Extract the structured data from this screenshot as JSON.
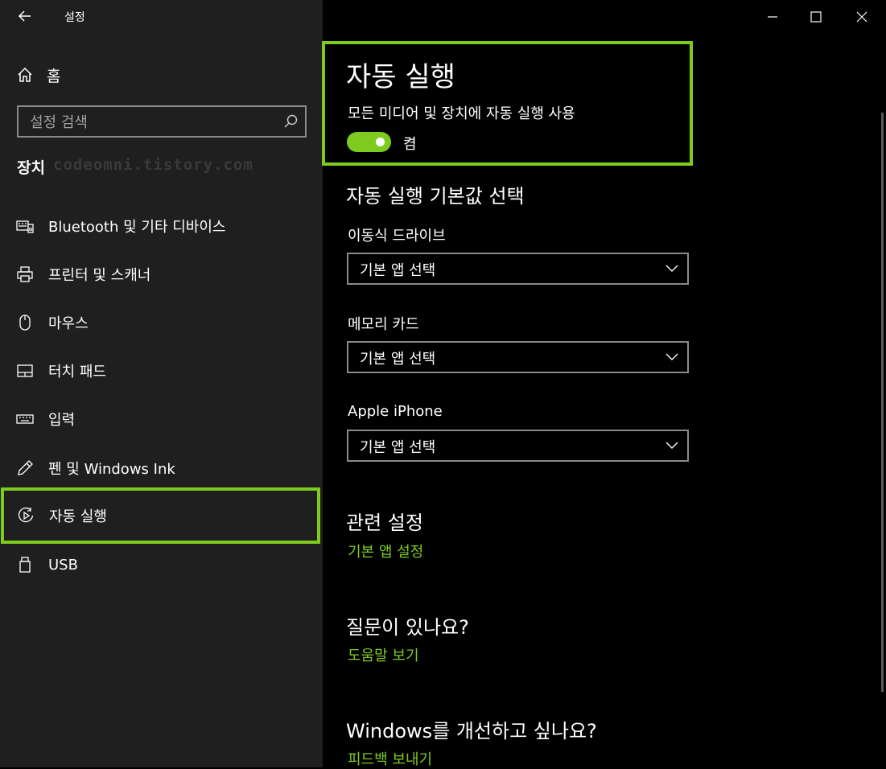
{
  "window": {
    "title": "설정"
  },
  "sidebar": {
    "home_label": "홈",
    "search_placeholder": "설정 검색",
    "section_heading": "장치",
    "watermark": "codeomni.tistory.com",
    "items": [
      {
        "label": "Bluetooth 및 기타 디바이스",
        "icon": "bluetooth-devices-icon"
      },
      {
        "label": "프린터 및 스캐너",
        "icon": "printer-icon"
      },
      {
        "label": "마우스",
        "icon": "mouse-icon"
      },
      {
        "label": "터치 패드",
        "icon": "touchpad-icon"
      },
      {
        "label": "입력",
        "icon": "keyboard-icon"
      },
      {
        "label": "펜 및 Windows Ink",
        "icon": "pen-icon"
      },
      {
        "label": "자동 실행",
        "icon": "autoplay-icon",
        "active": true
      },
      {
        "label": "USB",
        "icon": "usb-icon"
      }
    ]
  },
  "main": {
    "title": "자동 실행",
    "toggle_description": "모든 미디어 및 장치에 자동 실행 사용",
    "toggle_state": "켬",
    "toggle_on": true,
    "defaults_title": "자동 실행 기본값 선택",
    "fields": [
      {
        "label": "이동식 드라이브",
        "value": "기본 앱 선택"
      },
      {
        "label": "메모리 카드",
        "value": "기본 앱 선택"
      },
      {
        "label": "Apple iPhone",
        "value": "기본 앱 선택"
      }
    ],
    "related": {
      "title": "관련 설정",
      "link": "기본 앱 설정"
    },
    "help": {
      "title": "질문이 있나요?",
      "link": "도움말 보기"
    },
    "feedback": {
      "title": "Windows를 개선하고 싶나요?",
      "link": "피드백 보내기"
    }
  },
  "colors": {
    "accent": "#7ecb20",
    "sidebar_bg": "#1f1f1f",
    "main_bg": "#000000"
  }
}
